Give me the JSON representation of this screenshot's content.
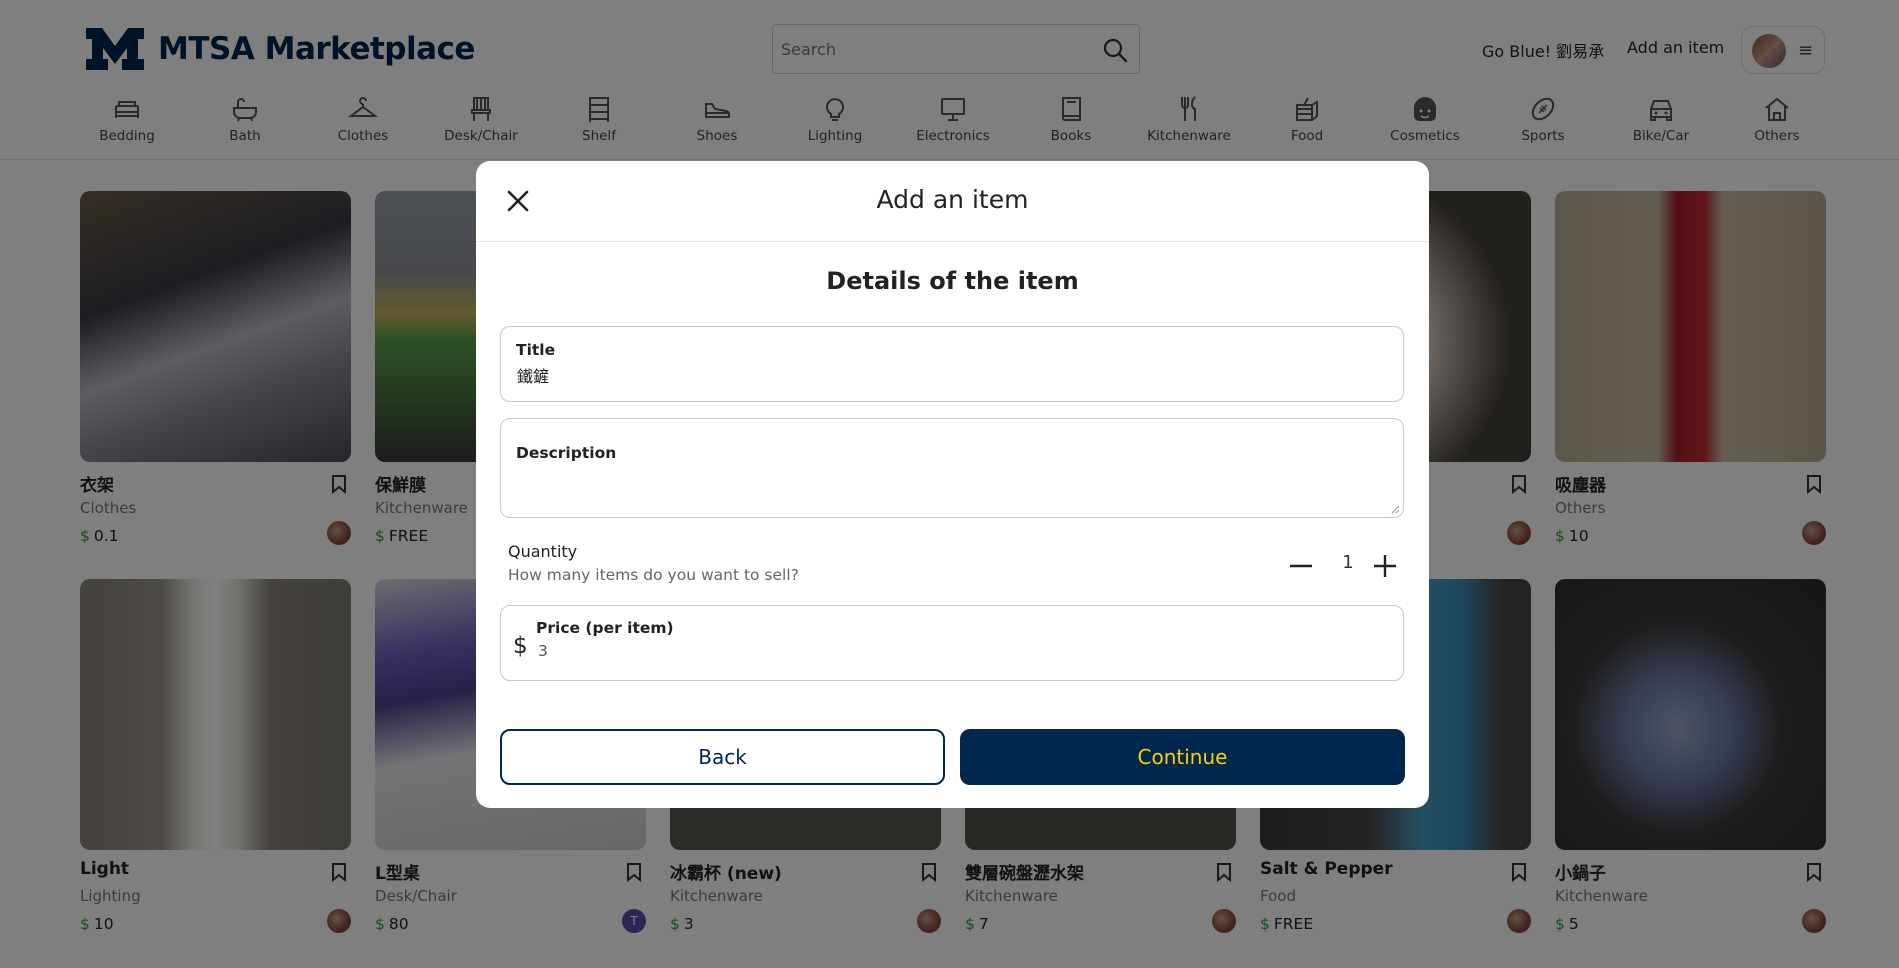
{
  "header": {
    "brand": "MTSA Marketplace",
    "search_placeholder": "Search",
    "greeting": "Go Blue!  劉易承",
    "add_item": "Add an item",
    "menu_glyph": "≡"
  },
  "categories": [
    "Bedding",
    "Bath",
    "Clothes",
    "Desk/Chair",
    "Shelf",
    "Shoes",
    "Lighting",
    "Electronics",
    "Books",
    "Kitchenware",
    "Food",
    "Cosmetics",
    "Sports",
    "Bike/Car",
    "Others"
  ],
  "items": [
    {
      "title": "衣架",
      "category": "Clothes",
      "price": "0.1"
    },
    {
      "title": "保鮮膜",
      "category": "Kitchenware",
      "price": "FREE"
    },
    {
      "title": "",
      "category": "",
      "price": ""
    },
    {
      "title": "",
      "category": "",
      "price": ""
    },
    {
      "title": "",
      "category": "",
      "price": ""
    },
    {
      "title": "吸塵器",
      "category": "Others",
      "price": "10"
    },
    {
      "title": "Light",
      "category": "Lighting",
      "price": "10"
    },
    {
      "title": "L型桌",
      "category": "Desk/Chair",
      "price": "80",
      "seller_initial": "T"
    },
    {
      "title": "冰霸杯 (new)",
      "category": "Kitchenware",
      "price": "3"
    },
    {
      "title": "雙層碗盤瀝水架",
      "category": "Kitchenware",
      "price": "7"
    },
    {
      "title": "Salt & Pepper",
      "category": "Food",
      "price": "FREE"
    },
    {
      "title": "小鍋子",
      "category": "Kitchenware",
      "price": "5"
    }
  ],
  "currency_symbol": "$",
  "modal": {
    "title": "Add an item",
    "section_title": "Details of the item",
    "title_label": "Title",
    "title_value": "鐵鏟",
    "description_label": "Description",
    "description_value": "",
    "quantity_label": "Quantity",
    "quantity_hint": "How many items do you want to sell?",
    "quantity_value": "1",
    "price_label": "Price (per item)",
    "price_value": "3",
    "back_label": "Back",
    "continue_label": "Continue"
  },
  "colors": {
    "brand_navy": "#00274C",
    "maize": "#FFCB05",
    "price_green": "#2a9d3a"
  }
}
